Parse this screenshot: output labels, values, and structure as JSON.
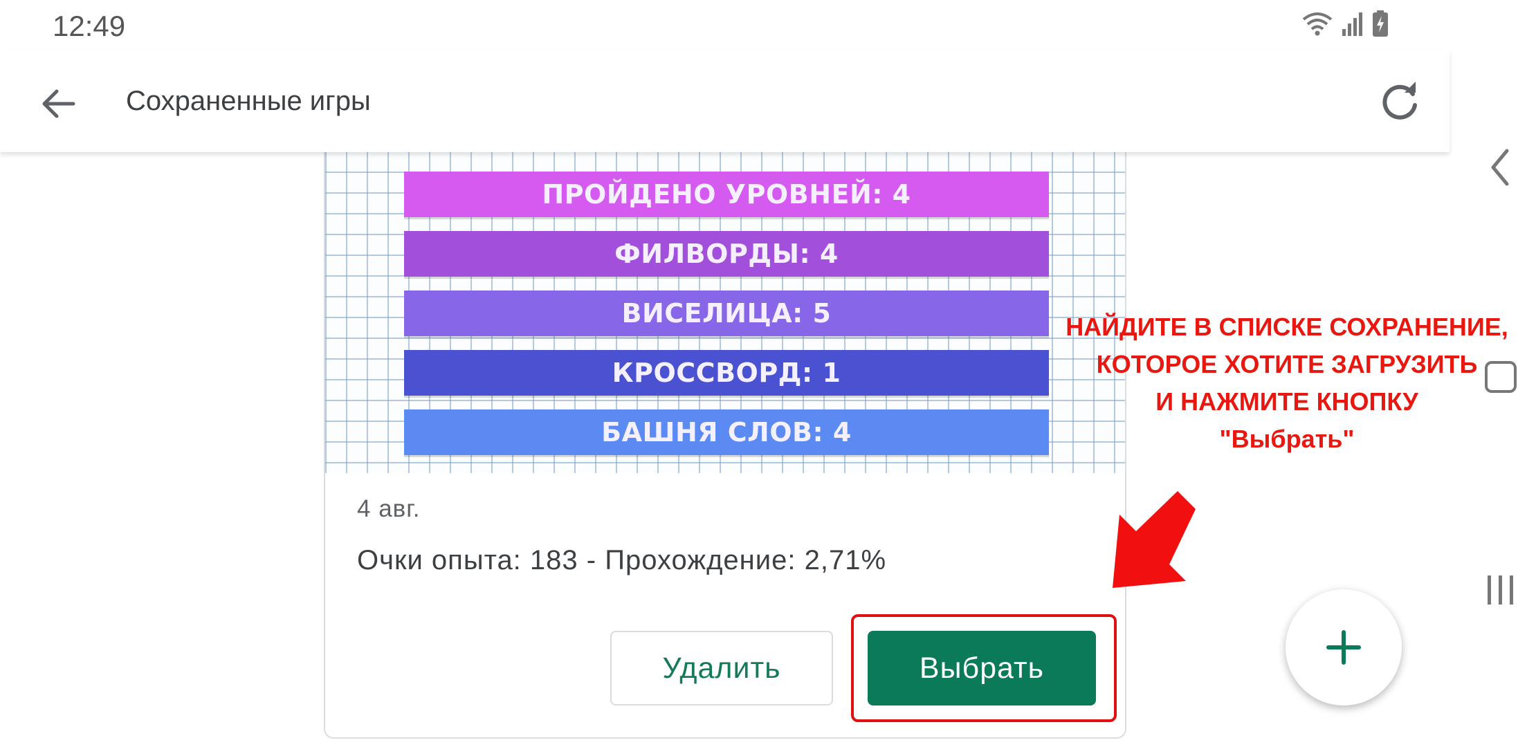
{
  "status_bar": {
    "time": "12:49"
  },
  "app_bar": {
    "title": "Сохраненные игры"
  },
  "save_card": {
    "stats_image": {
      "bars": [
        {
          "label": "ПРОЙДЕНО УРОВНЕЙ: 4",
          "color": "#d45af0"
        },
        {
          "label": "ФИЛВОРДЫ: 4",
          "color": "#a24fdc"
        },
        {
          "label": "ВИСЕЛИЦА: 5",
          "color": "#8866e8"
        },
        {
          "label": "КРОССВОРД: 1",
          "color": "#4a52d2"
        },
        {
          "label": "БАШНЯ СЛОВ: 4",
          "color": "#5a8af2"
        }
      ]
    },
    "date": "4 авг.",
    "stats": "Очки опыта: 183 - Прохождение: 2,71%",
    "delete_label": "Удалить",
    "select_label": "Выбрать"
  },
  "annotation": {
    "lines": [
      "НАЙДИТЕ В СПИСКЕ СОХРАНЕНИЕ,",
      "КОТОРОЕ ХОТИТЕ ЗАГРУЗИТЬ",
      "И НАЖМИТЕ КНОПКУ",
      "\"Выбрать\""
    ],
    "color": "#e8170f"
  },
  "colors": {
    "accent": "#0b7a58",
    "highlight": "#e01010"
  }
}
